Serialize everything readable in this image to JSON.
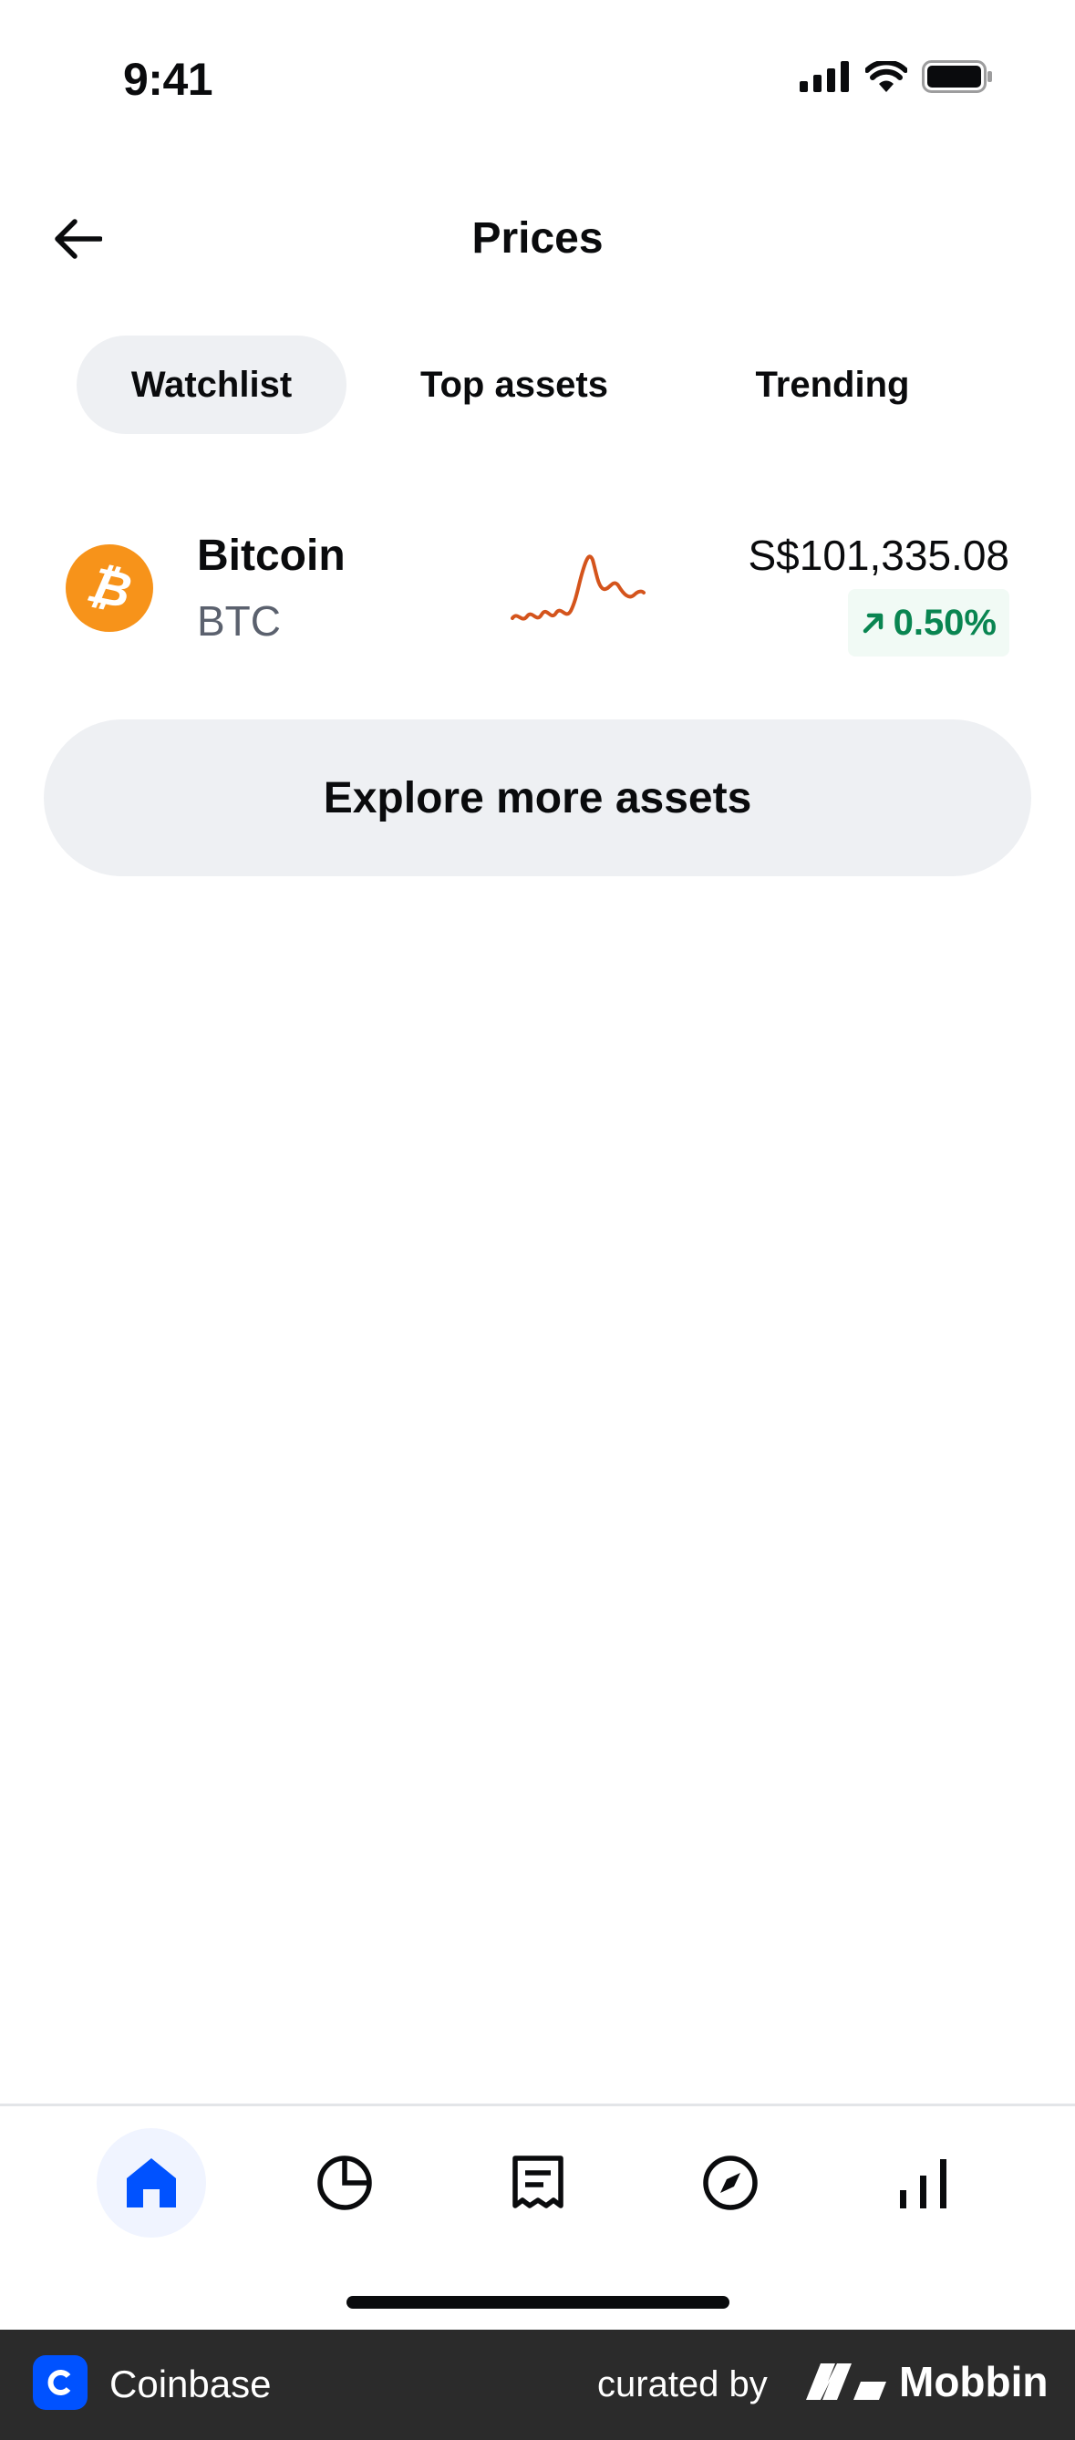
{
  "status_bar": {
    "time": "9:41",
    "icons": [
      "signal-icon",
      "wifi-icon",
      "battery-icon"
    ]
  },
  "header": {
    "title": "Prices",
    "back_icon": "arrow-left-icon"
  },
  "tabs": [
    {
      "label": "Watchlist",
      "active": true
    },
    {
      "label": "Top assets",
      "active": false
    },
    {
      "label": "Trending",
      "active": false
    }
  ],
  "watchlist": [
    {
      "name": "Bitcoin",
      "ticker": "BTC",
      "logo_glyph": "₿",
      "price": "S$101,335.08",
      "change": "0.50%",
      "change_direction": "up",
      "sparkline_color": "#d4541c"
    }
  ],
  "explore_button": {
    "label": "Explore more assets"
  },
  "bottom_nav": {
    "items": [
      {
        "icon": "home-icon",
        "active": true
      },
      {
        "icon": "portfolio-pie-icon",
        "active": false
      },
      {
        "icon": "transactions-receipt-icon",
        "active": false
      },
      {
        "icon": "explore-compass-icon",
        "active": false
      },
      {
        "icon": "bar-chart-icon",
        "active": false
      }
    ]
  },
  "footer": {
    "app_name": "Coinbase",
    "curated_label": "curated by",
    "brand": "Mobbin"
  },
  "colors": {
    "accent": "#0052ff",
    "positive": "#098551",
    "bitcoin": "#f7931a",
    "chip_bg": "#eef0f3"
  }
}
